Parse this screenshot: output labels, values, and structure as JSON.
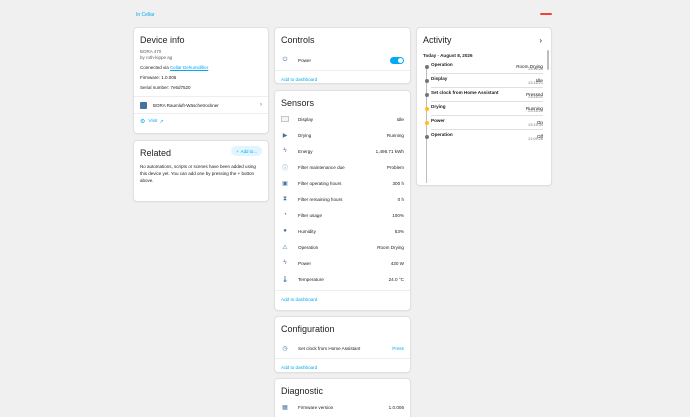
{
  "breadcrumb": "In Cellar",
  "device_info": {
    "title": "Device info",
    "model": "BORA 470",
    "manufacturer": "by roth-kippe ag",
    "connected_via_prefix": "Connected via ",
    "connected_via_link": "Cellar Dehumidifier",
    "firmware": "Firmware: 1.0.006",
    "serial": "Serial number: 7e6d7520",
    "linked_device": "BORA Raumluft-Wäschetrockner",
    "visit_label": "Visit"
  },
  "related": {
    "title": "Related",
    "add_button": "Add to...",
    "text": "No automations, scripts or scenes have been added using this device yet. You can add one by pressing the + button above."
  },
  "controls": {
    "title": "Controls",
    "rows": [
      {
        "name": "Power",
        "icon": "power-plug-icon",
        "on": true
      }
    ],
    "footer": "Add to dashboard"
  },
  "sensors": {
    "title": "Sensors",
    "rows": [
      {
        "name": "Display",
        "value": "Idle",
        "icon": "display-icon"
      },
      {
        "name": "Drying",
        "value": "Running",
        "icon": "play-icon"
      },
      {
        "name": "Energy",
        "value": "1,496.71 kWh",
        "icon": "lightning-icon"
      },
      {
        "name": "Filter maintenance due",
        "value": "Problem",
        "icon": "alert-circle-icon"
      },
      {
        "name": "Filter operating hours",
        "value": "300 h",
        "icon": "filter-icon"
      },
      {
        "name": "Filter remaining hours",
        "value": "0 h",
        "icon": "hourglass-icon"
      },
      {
        "name": "Filter usage",
        "value": "100%",
        "icon": "gauge-icon"
      },
      {
        "name": "Humidity",
        "value": "53%",
        "icon": "water-drop-icon"
      },
      {
        "name": "Operation",
        "value": "Room Drying",
        "icon": "sitemap-icon"
      },
      {
        "name": "Power",
        "value": "430 W",
        "icon": "flash-icon"
      },
      {
        "name": "Temperature",
        "value": "24.0 °C",
        "icon": "thermometer-icon"
      }
    ],
    "footer": "Add to dashboard"
  },
  "configuration": {
    "title": "Configuration",
    "rows": [
      {
        "name": "Set clock from Home Assistant",
        "action": "Press",
        "icon": "clock-icon"
      }
    ],
    "footer": "Add to dashboard"
  },
  "diagnostic": {
    "title": "Diagnostic",
    "rows": [
      {
        "name": "Firmware version",
        "value": "1.0.006",
        "icon": "chip-icon"
      }
    ]
  },
  "activity": {
    "title": "Activity",
    "date": "Today · August 8, 2026",
    "items": [
      {
        "name": "Operation",
        "state": "Room Drying",
        "time": "23:16:21",
        "dot": "#757575"
      },
      {
        "name": "Display",
        "state": "Idle",
        "time": "23:16:21",
        "dot": "#757575"
      },
      {
        "name": "Set clock from Home Assistant",
        "state": "Pressed",
        "time": "23:16:21",
        "dot": "#757575"
      },
      {
        "name": "Drying",
        "state": "Running",
        "time": "23:16:21",
        "dot": "#ffc107"
      },
      {
        "name": "Power",
        "state": "On",
        "time": "23:15:39",
        "dot": "#ffc107"
      },
      {
        "name": "Operation",
        "state": "Off",
        "time": "21:09:26",
        "dot": "#757575"
      }
    ]
  },
  "colors": {
    "accent": "#03a9f4",
    "icon": "#44739e",
    "warn": "#ffc107"
  }
}
